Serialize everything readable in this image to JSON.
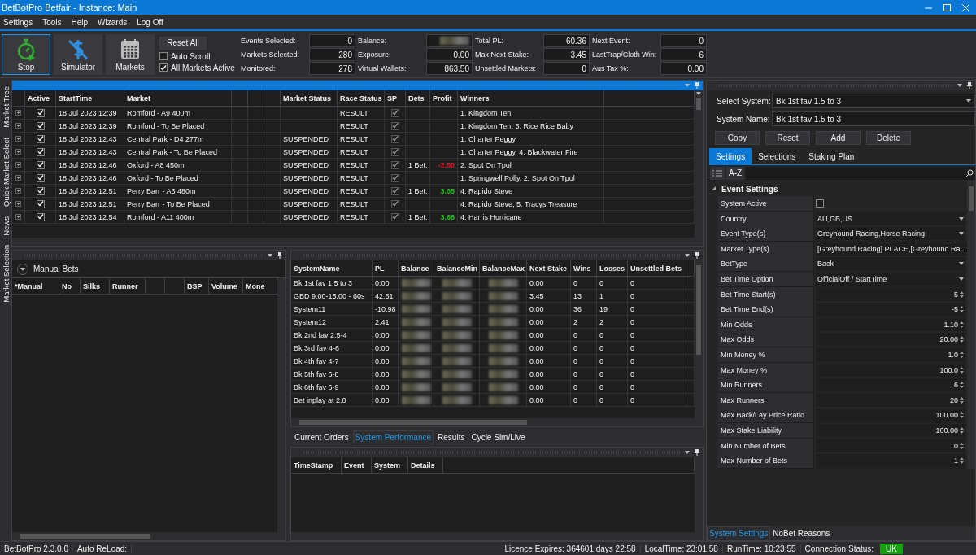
{
  "window": {
    "title": "BetBotPro Betfair - Instance: Main"
  },
  "menu": [
    "Settings",
    "Tools",
    "Help",
    "Wizards",
    "Log Off"
  ],
  "toolbar": {
    "buttons": [
      {
        "label": "Stop",
        "kind": "stop",
        "selected": true
      },
      {
        "label": "Simulator",
        "kind": "simulator",
        "selected": false
      },
      {
        "label": "Markets",
        "kind": "markets",
        "selected": false
      }
    ],
    "reset_button": "Reset All",
    "checkboxes": [
      {
        "label": "Auto Scroll",
        "checked": false
      },
      {
        "label": "All Markets Active",
        "checked": true
      }
    ],
    "stat_columns": [
      [
        {
          "label": "Events Selected:",
          "value": "0"
        },
        {
          "label": "Markets Selected:",
          "value": "280"
        },
        {
          "label": "Monitored:",
          "value": "278"
        }
      ],
      [
        {
          "label": "Balance:",
          "redacted": true
        },
        {
          "label": "Exposure:",
          "value": "0.00"
        },
        {
          "label": "Virtual Wallets:",
          "value": "863.50"
        }
      ],
      [
        {
          "label": "Total PL:",
          "value": "60.36"
        },
        {
          "label": "Max Next Stake:",
          "value": "3.45"
        },
        {
          "label": "Unsettled Markets:",
          "value": "0"
        }
      ],
      [
        {
          "label": "Next Event:",
          "value": "0"
        },
        {
          "label": "LastTrap/Cloth Win:",
          "value": "6"
        },
        {
          "label": "Aus Tax %:",
          "value": "0.00"
        }
      ]
    ]
  },
  "side_tabs": [
    "Market Tree",
    "Quick Market Select",
    "News",
    "Market Selection"
  ],
  "markets": {
    "active": true,
    "columns": [
      {
        "kind": "blank"
      },
      {
        "kind": "text",
        "label": "Active"
      },
      {
        "kind": "text",
        "label": "StartTime"
      },
      {
        "kind": "text",
        "label": "Market"
      },
      {
        "kind": "blank"
      },
      {
        "kind": "blank"
      },
      {
        "kind": "blank"
      },
      {
        "kind": "text",
        "label": "Market Status"
      },
      {
        "kind": "text",
        "label": "Race Status"
      },
      {
        "kind": "text",
        "label": "SP"
      },
      {
        "kind": "text",
        "label": "Bets"
      },
      {
        "kind": "text",
        "label": "Profit"
      },
      {
        "kind": "text",
        "label": "Winners"
      }
    ],
    "rows": [
      {
        "active": true,
        "start_time": "18 Jul 2023 12:39",
        "market": "Romford - A9 400m",
        "race_status": "RESULT",
        "sp": true,
        "winners": "1. Kingdom Ten"
      },
      {
        "active": true,
        "start_time": "18 Jul 2023 12:39",
        "market": "Romford - To Be Placed",
        "race_status": "RESULT",
        "sp": true,
        "winners": "1. Kingdom Ten, 5. Rice Rice Baby"
      },
      {
        "active": true,
        "start_time": "18 Jul 2023 12:43",
        "market": "Central Park - D4 277m",
        "market_status": "SUSPENDED",
        "race_status": "RESULT",
        "sp": true,
        "winners": "1. Charter Peggy"
      },
      {
        "active": true,
        "start_time": "18 Jul 2023 12:43",
        "market": "Central Park - To Be Placed",
        "market_status": "SUSPENDED",
        "race_status": "RESULT",
        "sp": true,
        "winners": "1. Charter Peggy, 4. Blackwater Fire"
      },
      {
        "active": true,
        "start_time": "18 Jul 2023 12:46",
        "market": "Oxford - A8 450m",
        "market_status": "SUSPENDED",
        "race_status": "RESULT",
        "sp": true,
        "bets": "1 Bet.",
        "profit": "-2.50",
        "color": "#e81123",
        "winners": "2. Spot On Tpol"
      },
      {
        "active": true,
        "start_time": "18 Jul 2023 12:46",
        "market": "Oxford - To Be Placed",
        "market_status": "SUSPENDED",
        "race_status": "RESULT",
        "sp": true,
        "winners": "1. Springwell Polly, 2. Spot On Tpol"
      },
      {
        "active": true,
        "start_time": "18 Jul 2023 12:51",
        "market": "Perry Barr - A3 480m",
        "market_status": "SUSPENDED",
        "race_status": "RESULT",
        "sp": true,
        "bets": "1 Bet.",
        "profit": "3.05",
        "color": "#16c60c",
        "winners": "4. Rapido Steve"
      },
      {
        "active": true,
        "start_time": "18 Jul 2023 12:51",
        "market": "Perry Barr - To Be Placed",
        "market_status": "SUSPENDED",
        "race_status": "RESULT",
        "sp": true,
        "winners": "4. Rapido Steve, 5. Tracys Treasure"
      },
      {
        "active": true,
        "start_time": "18 Jul 2023 12:54",
        "market": "Romford - A11 400m",
        "market_status": "SUSPENDED",
        "race_status": "RESULT",
        "sp": true,
        "bets": "1 Bet.",
        "profit": "3.66",
        "color": "#16c60c",
        "winners": "4. Harris Hurricane"
      }
    ]
  },
  "manual_bets": {
    "title": "Manual Bets",
    "columns": [
      {
        "kind": "text",
        "label": "*Manual"
      },
      {
        "kind": "text",
        "label": "No"
      },
      {
        "kind": "text",
        "label": "Silks"
      },
      {
        "kind": "text",
        "label": "Runner"
      },
      {
        "kind": "blank"
      },
      {
        "kind": "blank"
      },
      {
        "kind": "text",
        "label": "BSP"
      },
      {
        "kind": "text",
        "label": "Volume"
      },
      {
        "kind": "text",
        "label": "Mone"
      }
    ]
  },
  "systems": {
    "columns": [
      {
        "label": "SystemName"
      },
      {
        "label": "PL"
      },
      {
        "label": "Balance",
        "redacted": true
      },
      {
        "label": "BalanceMin",
        "redacted": true
      },
      {
        "label": "BalanceMax",
        "redacted": true
      },
      {
        "label": "Next Stake"
      },
      {
        "label": "Wins"
      },
      {
        "label": "Losses"
      },
      {
        "label": "Unsettled Bets"
      }
    ],
    "rows": [
      {
        "name": "Bk 1st fav 1.5 to 3",
        "pl": "0.00",
        "next_stake": "0.00",
        "wins": "0",
        "losses": "0",
        "unsettled_bets": "0"
      },
      {
        "name": "GBD 9.00-15.00 - 60s",
        "pl": "42.51",
        "next_stake": "3.45",
        "wins": "13",
        "losses": "1",
        "unsettled_bets": "0"
      },
      {
        "name": "System11",
        "pl": "-10.98",
        "next_stake": "0.00",
        "wins": "36",
        "losses": "19",
        "unsettled_bets": "0"
      },
      {
        "name": "System12",
        "pl": "2.41",
        "next_stake": "0.00",
        "wins": "2",
        "losses": "2",
        "unsettled_bets": "0"
      },
      {
        "name": "Bk 2nd fav 2.5-4",
        "pl": "0.00",
        "next_stake": "0.00",
        "wins": "0",
        "losses": "0",
        "unsettled_bets": "0"
      },
      {
        "name": "Bk 3rd fav 4-6",
        "pl": "0.00",
        "next_stake": "0.00",
        "wins": "0",
        "losses": "0",
        "unsettled_bets": "0"
      },
      {
        "name": "Bk 4th fav 4-7",
        "pl": "0.00",
        "next_stake": "0.00",
        "wins": "0",
        "losses": "0",
        "unsettled_bets": "0"
      },
      {
        "name": "Bk 5th fav 6-8",
        "pl": "0.00",
        "next_stake": "0.00",
        "wins": "0",
        "losses": "0",
        "unsettled_bets": "0"
      },
      {
        "name": "Bk 6th fav 6-9",
        "pl": "0.00",
        "next_stake": "0.00",
        "wins": "0",
        "losses": "0",
        "unsettled_bets": "0"
      },
      {
        "name": "Bet inplay at 2.0",
        "pl": "0.00",
        "next_stake": "0.00",
        "wins": "0",
        "losses": "0",
        "unsettled_bets": "0"
      }
    ]
  },
  "bottom_tabs": [
    {
      "label": "Current Orders",
      "selected": false
    },
    {
      "label": "System Performance",
      "selected": true
    },
    {
      "label": "Results",
      "selected": false
    },
    {
      "label": "Cycle Sim/Live",
      "selected": false
    }
  ],
  "events": {
    "columns": [
      "TimeStamp",
      "Event",
      "System",
      "Details"
    ]
  },
  "system_panel": {
    "select_label": "Select System:",
    "select_value": "Bk 1st fav 1.5 to 3",
    "name_label": "System Name:",
    "name_value": "Bk 1st fav 1.5 to 3",
    "buttons": [
      "Copy",
      "Reset",
      "Add",
      "Delete"
    ],
    "tabs": [
      {
        "label": "Settings",
        "selected": true
      },
      {
        "label": "Selections",
        "selected": false
      },
      {
        "label": "Staking Plan",
        "selected": false
      }
    ],
    "sort_button": "A-Z",
    "category": {
      "label": "Event Settings",
      "expanded": true
    },
    "properties": [
      {
        "label": "System Active",
        "kind": "check",
        "checked": false
      },
      {
        "label": "Country",
        "kind": "dropdown",
        "value": "AU,GB,US"
      },
      {
        "label": "Event Type(s)",
        "kind": "dropdown",
        "value": "Greyhound Racing,Horse Racing"
      },
      {
        "label": "Market Type(s)",
        "kind": "dropdown",
        "value": "[Greyhound Racing] PLACE,[Greyhound Ra..."
      },
      {
        "label": "BetType",
        "kind": "dropdown",
        "value": "Back"
      },
      {
        "label": "Bet Time Option",
        "kind": "dropdown",
        "value": "OfficialOff / StartTime"
      },
      {
        "label": "Bet Time Start(s)",
        "kind": "number",
        "value": "5"
      },
      {
        "label": "Bet Time End(s)",
        "kind": "number",
        "value": "-5"
      },
      {
        "label": "Min Odds",
        "kind": "number",
        "value": "1.10"
      },
      {
        "label": "Max Odds",
        "kind": "number",
        "value": "20.00"
      },
      {
        "label": "Min Money %",
        "kind": "number",
        "value": "1.0"
      },
      {
        "label": "Max Money %",
        "kind": "number",
        "value": "100.0"
      },
      {
        "label": "Min Runners",
        "kind": "number",
        "value": "6"
      },
      {
        "label": "Max Runners",
        "kind": "number",
        "value": "20"
      },
      {
        "label": "Max Back/Lay Price Ratio",
        "kind": "number",
        "value": "100.00"
      },
      {
        "label": "Max Stake Liability",
        "kind": "number",
        "value": "100.00"
      },
      {
        "label": "Min Number of Bets",
        "kind": "number",
        "value": "0"
      },
      {
        "label": "Max Number of Bets",
        "kind": "number",
        "value": "1"
      }
    ],
    "bottom_tabs": [
      {
        "label": "System Settings",
        "selected": true
      },
      {
        "label": "NoBet Reasons",
        "selected": false
      }
    ]
  },
  "status_bar": {
    "left": [
      "BetBotPro 2.3.0.0",
      "Auto ReLoad:"
    ],
    "right": [
      "Licence Expires: 364601 days 22:58",
      "LocalTime: 23:01:58",
      "RunTime: 10:23:55",
      "Connection Status:"
    ],
    "connection": {
      "label": "UK",
      "connected": true
    }
  }
}
